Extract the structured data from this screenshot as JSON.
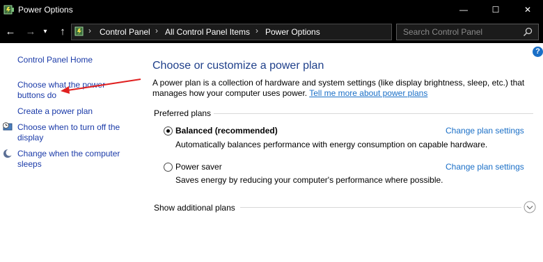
{
  "window": {
    "title": "Power Options",
    "minimize_glyph": "—",
    "maximize_glyph": "☐",
    "close_glyph": "✕"
  },
  "nav": {
    "back_glyph": "←",
    "forward_glyph": "→",
    "recent_glyph": "▾",
    "up_glyph": "↑"
  },
  "address": {
    "separator": "›",
    "crumbs": [
      "Control Panel",
      "All Control Panel Items",
      "Power Options"
    ]
  },
  "search": {
    "placeholder": "Search Control Panel"
  },
  "help": {
    "glyph": "?"
  },
  "sidebar": {
    "home": "Control Panel Home",
    "items": [
      {
        "label_line1": "Choose what the power",
        "label_line2": "buttons do"
      },
      {
        "label_line1": "Create a power plan"
      },
      {
        "label_line1": "Choose when to turn off the",
        "label_line2": "display",
        "icon": "monitor-clock-icon"
      },
      {
        "label_line1": "Change when the computer",
        "label_line2": "sleeps",
        "icon": "moon-icon"
      }
    ]
  },
  "main": {
    "heading": "Choose or customize a power plan",
    "description": "A power plan is a collection of hardware and system settings (like display brightness, sleep, etc.) that manages how your computer uses power.",
    "learn_more": "Tell me more about power plans",
    "group_label": "Preferred plans",
    "plans": [
      {
        "name": "Balanced (recommended)",
        "description": "Automatically balances performance with energy consumption on capable hardware.",
        "settings_link": "Change plan settings",
        "selected": true
      },
      {
        "name": "Power saver",
        "description": "Saves energy by reducing your computer's performance where possible.",
        "settings_link": "Change plan settings",
        "selected": false
      }
    ],
    "show_additional": "Show additional plans"
  },
  "colors": {
    "link": "#1a6fc7",
    "heading": "#1e3f8a",
    "annotation_arrow": "#e02020",
    "titlebar": "#000000"
  }
}
